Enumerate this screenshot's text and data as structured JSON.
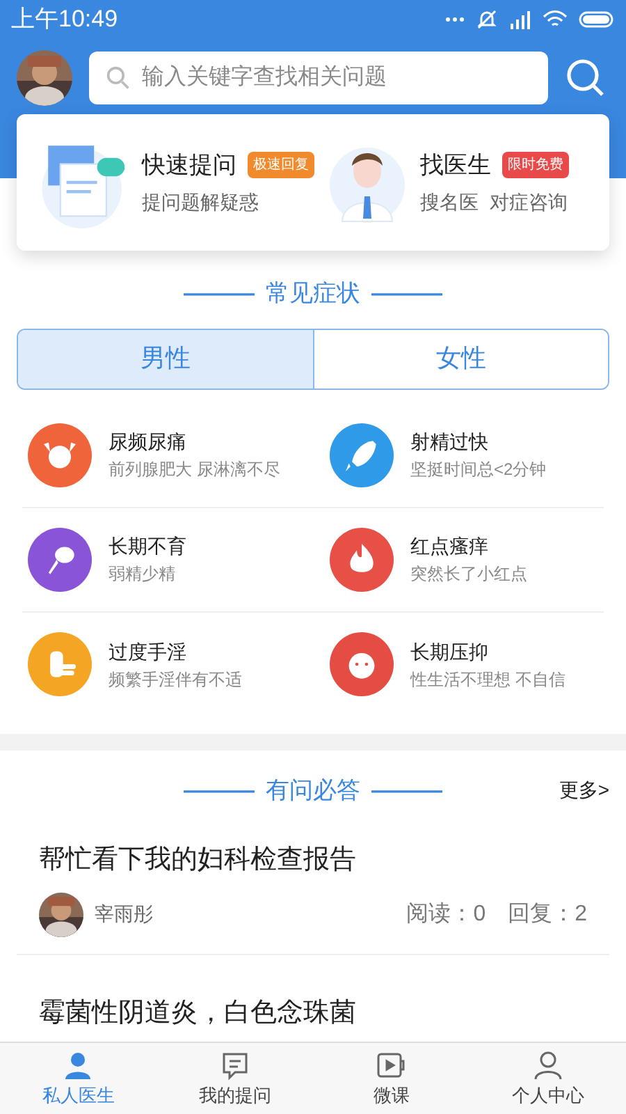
{
  "status_bar": {
    "time": "上午10:49"
  },
  "search": {
    "placeholder": "输入关键字查找相关问题"
  },
  "services": [
    {
      "kind": "ask",
      "title": "快速提问",
      "badge": "极速回复",
      "color": "#f08a2c",
      "subtitle": "提问题解疑惑"
    },
    {
      "kind": "doctor",
      "title": "找医生",
      "badge": "限时免费",
      "color": "#e84a4a",
      "subtitle": "搜名医  对症咨询"
    }
  ],
  "symptoms_section": {
    "title": "常见症状",
    "dash": "———"
  },
  "gender_tabs": [
    {
      "label": "男性",
      "selected": true
    },
    {
      "label": "女性",
      "selected": false
    }
  ],
  "symptoms": [
    {
      "kind": "bull",
      "color": "#f0643c",
      "title": "尿频尿痛",
      "subtitle": "前列腺肥大 尿淋漓不尽"
    },
    {
      "kind": "rocket",
      "color": "#2f9be8",
      "title": "射精过快",
      "subtitle": "坚挺时间总<2分钟"
    },
    {
      "kind": "sperm",
      "color": "#8a54d8",
      "title": "长期不育",
      "subtitle": "弱精少精"
    },
    {
      "kind": "flame",
      "color": "#e65046",
      "title": "红点瘙痒",
      "subtitle": "突然长了小红点"
    },
    {
      "kind": "hand",
      "color": "#f5a524",
      "title": "过度手淫",
      "subtitle": "频繁手淫伴有不适"
    },
    {
      "kind": "face",
      "color": "#e44d43",
      "title": "长期压抑",
      "subtitle": "性生活不理想 不自信"
    }
  ],
  "qa_section": {
    "title": "有问必答",
    "dash": "———",
    "more": "更多>"
  },
  "questions": [
    {
      "title": "帮忙看下我的妇科检查报告",
      "author": "宰雨彤",
      "reads": "阅读：0",
      "replies": "回复：2"
    },
    {
      "title": "霉菌性阴道炎，白色念珠菌"
    }
  ],
  "tab_bar": [
    {
      "kind": "doctor",
      "label": "私人医生",
      "selected": true
    },
    {
      "kind": "chat",
      "label": "我的提问",
      "selected": false
    },
    {
      "kind": "video",
      "label": "微课",
      "selected": false
    },
    {
      "kind": "person",
      "label": "个人中心",
      "selected": false
    }
  ]
}
